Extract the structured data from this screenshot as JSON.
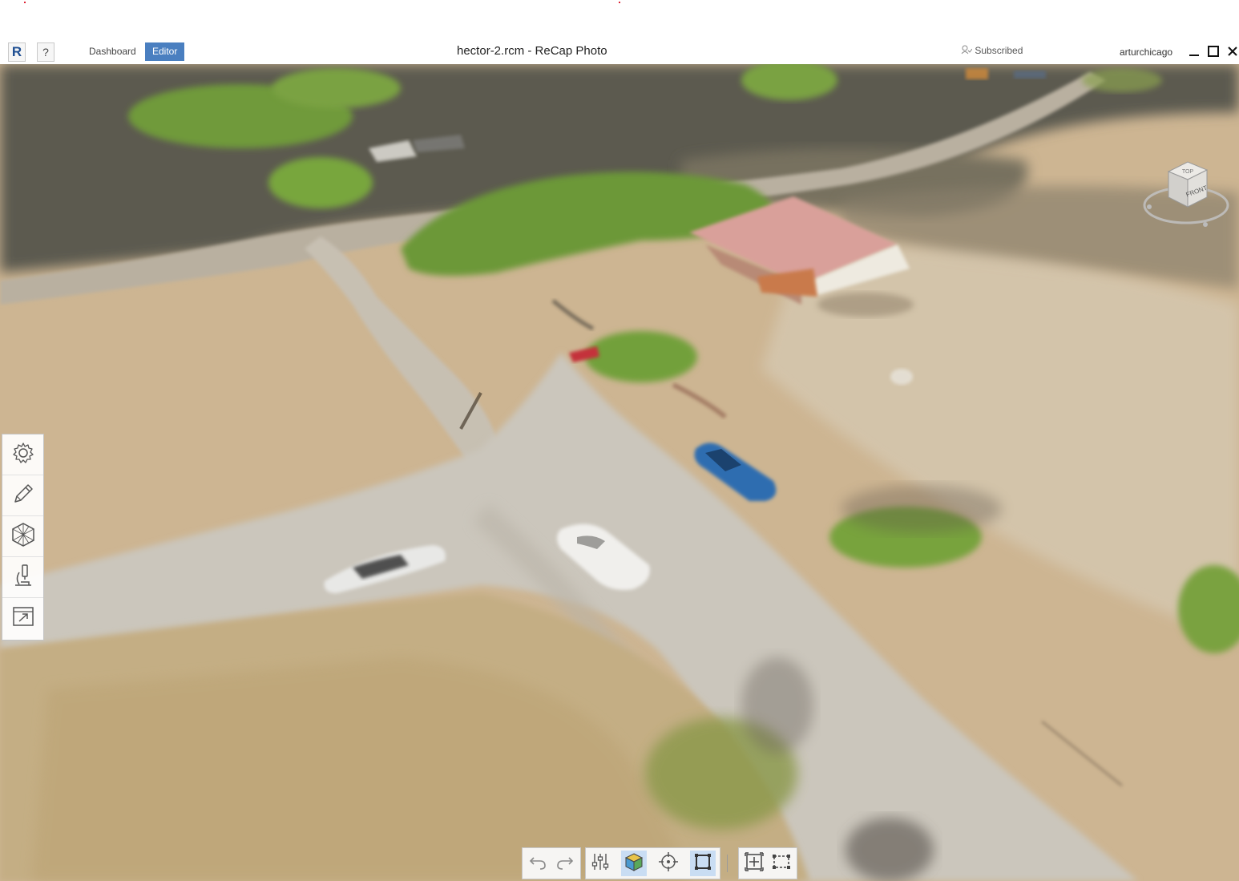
{
  "window": {
    "title": "hector-2.rcm - ReCap Photo",
    "logo_letter": "R",
    "help_label": "?",
    "tabs": [
      {
        "label": "Dashboard",
        "active": false
      },
      {
        "label": "Editor",
        "active": true
      }
    ],
    "subscription": "Subscribed",
    "username": "arturchicago"
  },
  "viewcube": {
    "face_top": "TOP",
    "face_front": "FRONT"
  },
  "left_toolbar": {
    "items": [
      {
        "name": "settings",
        "icon": "gear-icon"
      },
      {
        "name": "edit",
        "icon": "pencil-icon"
      },
      {
        "name": "mesh",
        "icon": "hexagon-mesh-icon"
      },
      {
        "name": "measure",
        "icon": "microscope-icon"
      },
      {
        "name": "export",
        "icon": "export-icon"
      }
    ]
  },
  "bottom_toolbar": {
    "buttons": [
      {
        "name": "undo",
        "icon": "undo-icon",
        "active": false
      },
      {
        "name": "redo",
        "icon": "redo-icon",
        "active": false
      },
      {
        "name": "adjust",
        "icon": "sliders-icon",
        "active": false
      },
      {
        "name": "render-mode",
        "icon": "cube-icon",
        "active": true
      },
      {
        "name": "orbit-center",
        "icon": "crosshair-icon",
        "active": false
      },
      {
        "name": "perspective",
        "icon": "frame-icon",
        "active": true
      },
      {
        "name": "zoom-extents",
        "icon": "zoom-extents-icon",
        "active": false
      },
      {
        "name": "zoom-window",
        "icon": "zoom-window-icon",
        "active": false
      }
    ]
  },
  "colors": {
    "accent": "#4a7fc0",
    "active_button": "#c9ddf3",
    "terrain": "#cdb592",
    "road": "#c9c3b8",
    "vegetation": "#6f9a3a"
  }
}
